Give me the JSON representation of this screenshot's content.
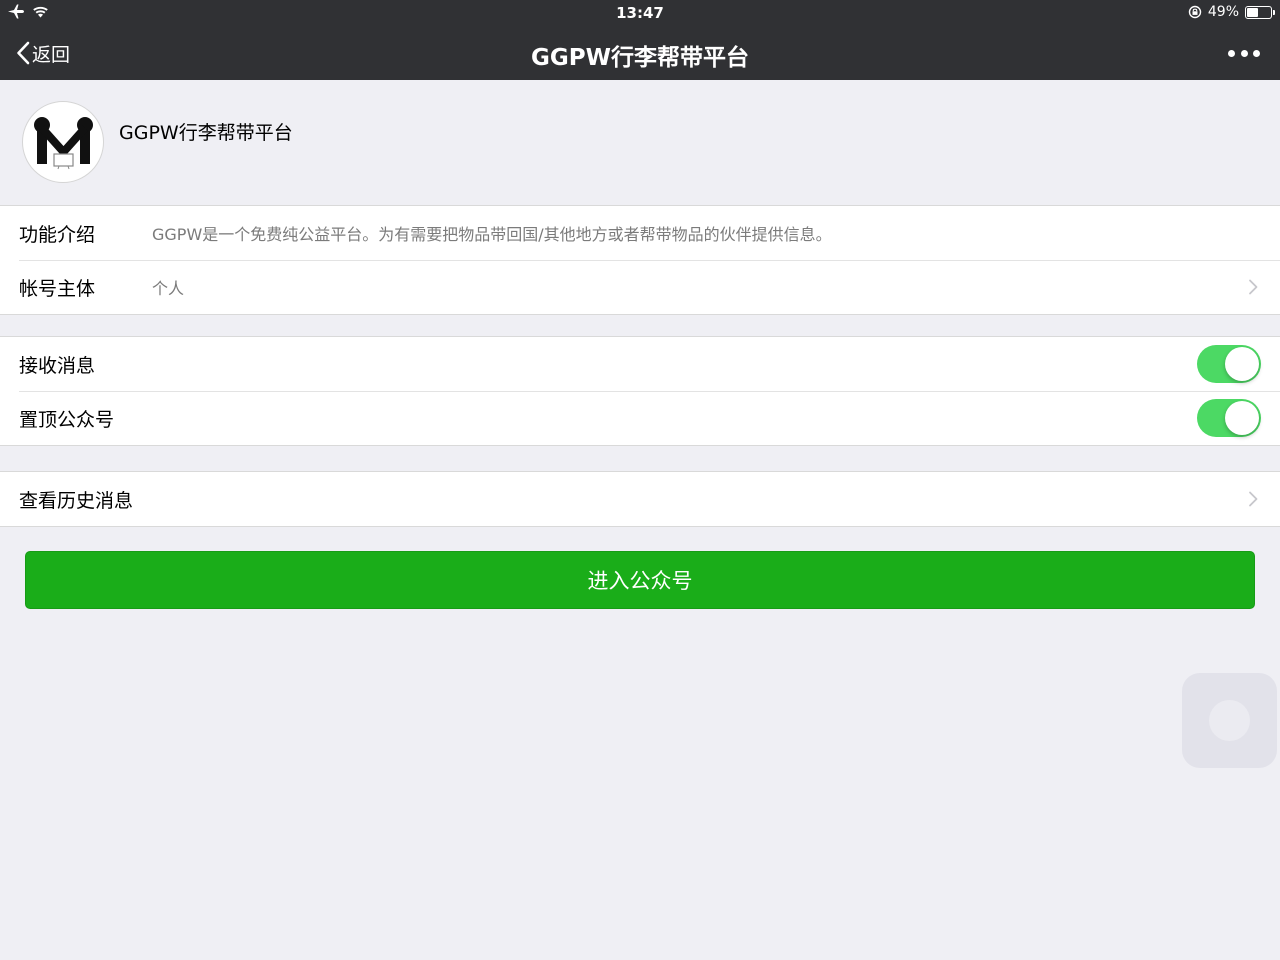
{
  "status_bar": {
    "time": "13:47",
    "battery_text": "49%",
    "battery_level": 0.49,
    "icons": [
      "airplane-icon",
      "wifi-icon",
      "rotation-lock-icon",
      "battery-icon"
    ]
  },
  "nav": {
    "back_label": "返回",
    "title": "GGPW行李帮带平台",
    "more_icon": "more-dots-icon"
  },
  "profile": {
    "name": "GGPW行李帮带平台",
    "avatar_icon": "ggpw-logo-icon"
  },
  "info": {
    "rows": [
      {
        "label": "功能介绍",
        "value": "GGPW是一个免费纯公益平台。为有需要把物品带回国/其他地方或者帮带物品的伙伴提供信息。"
      },
      {
        "label": "帐号主体",
        "value": "个人"
      }
    ]
  },
  "settings": {
    "rows": [
      {
        "label": "接收消息",
        "on": true
      },
      {
        "label": "置顶公众号",
        "on": true
      }
    ]
  },
  "history": {
    "label": "查看历史消息"
  },
  "enter_button": {
    "label": "进入公众号",
    "color": "#1aad19"
  },
  "colors": {
    "navbar": "#303134",
    "background": "#efeff4",
    "switch_on": "#4cd964",
    "accent_green": "#1aad19"
  }
}
